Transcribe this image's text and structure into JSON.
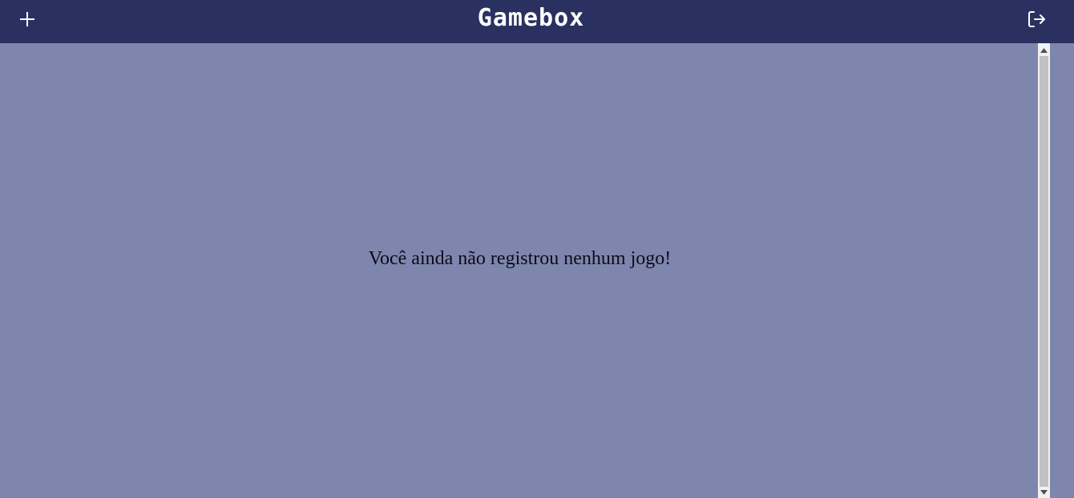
{
  "header": {
    "title": "Gamebox",
    "add_icon": "plus-icon",
    "logout_icon": "logout-icon"
  },
  "main": {
    "empty_message": "Você ainda não registrou nenhum jogo!"
  },
  "colors": {
    "header_bg": "#2a3160",
    "page_bg": "#7f86ad",
    "text": "#0b0b18",
    "header_text": "#ffffff"
  }
}
